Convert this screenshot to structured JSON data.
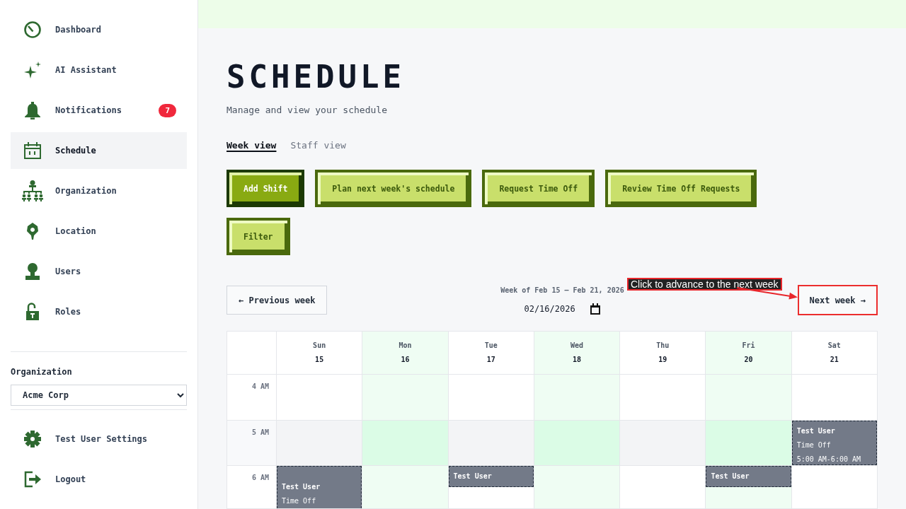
{
  "sidebar": {
    "nav_items": [
      {
        "label": "Dashboard",
        "selected": false
      },
      {
        "label": "AI Assistant",
        "selected": false
      },
      {
        "label": "Notifications",
        "selected": false,
        "badge": "7"
      },
      {
        "label": "Schedule",
        "selected": true
      },
      {
        "label": "Organization",
        "selected": false
      },
      {
        "label": "Location",
        "selected": false
      },
      {
        "label": "Users",
        "selected": false
      },
      {
        "label": "Roles",
        "selected": false
      }
    ],
    "organization_picker": {
      "label": "Organization",
      "value": "Acme Corp"
    },
    "footer_items": [
      {
        "label": "Test User Settings"
      },
      {
        "label": "Logout"
      }
    ]
  },
  "header": {
    "title": "SCHEDULE",
    "subtitle": "Manage and view your schedule"
  },
  "view_tabs": [
    {
      "label": "Week view",
      "selected": true
    },
    {
      "label": "Staff view",
      "selected": false
    }
  ],
  "actions": [
    {
      "label": "Add Shift",
      "kind": "primary"
    },
    {
      "label": "Plan next week's schedule",
      "kind": "secondary"
    },
    {
      "label": "Request Time Off",
      "kind": "secondary"
    },
    {
      "label": "Review Time Off Requests",
      "kind": "secondary"
    },
    {
      "label": "Filter",
      "kind": "secondary"
    }
  ],
  "week_nav": {
    "previous": "← Previous week",
    "range": "Week of Feb 15 – Feb 21, 2026",
    "date": "02/16/2026",
    "next": {
      "label": "Next week →",
      "highlighted": true
    }
  },
  "callout": {
    "text": "Click to advance to the next week"
  },
  "calendar": {
    "days": [
      {
        "name": "Sun",
        "date": "15",
        "tinted": false
      },
      {
        "name": "Mon",
        "date": "16",
        "tinted": true
      },
      {
        "name": "Tue",
        "date": "17",
        "tinted": false
      },
      {
        "name": "Wed",
        "date": "18",
        "tinted": true
      },
      {
        "name": "Thu",
        "date": "19",
        "tinted": false
      },
      {
        "name": "Fri",
        "date": "20",
        "tinted": true
      },
      {
        "name": "Sat",
        "date": "21",
        "tinted": false
      }
    ],
    "rows": [
      {
        "time": "4 AM",
        "shaded": false,
        "cells": [
          {
            "kind": "empty"
          },
          {
            "kind": "empty"
          },
          {
            "kind": "empty"
          },
          {
            "kind": "empty"
          },
          {
            "kind": "empty"
          },
          {
            "kind": "empty"
          },
          {
            "kind": "empty"
          }
        ]
      },
      {
        "time": "5 AM",
        "shaded": true,
        "cells": [
          {
            "kind": "empty"
          },
          {
            "kind": "empty"
          },
          {
            "kind": "empty"
          },
          {
            "kind": "empty"
          },
          {
            "kind": "empty"
          },
          {
            "kind": "empty"
          },
          {
            "kind": "hour-event",
            "title": "Test User",
            "detail": "Time Off",
            "time": "5:00 AM-6:00 AM"
          }
        ]
      },
      {
        "time": "6 AM",
        "shaded": false,
        "cells": [
          {
            "kind": "long-event",
            "title": "Test User",
            "detail": "Time Off"
          },
          {
            "kind": "empty"
          },
          {
            "kind": "half-event",
            "title": "Test User"
          },
          {
            "kind": "empty"
          },
          {
            "kind": "empty"
          },
          {
            "kind": "half-event",
            "title": "Test User"
          },
          {
            "kind": "empty"
          }
        ]
      }
    ]
  }
}
